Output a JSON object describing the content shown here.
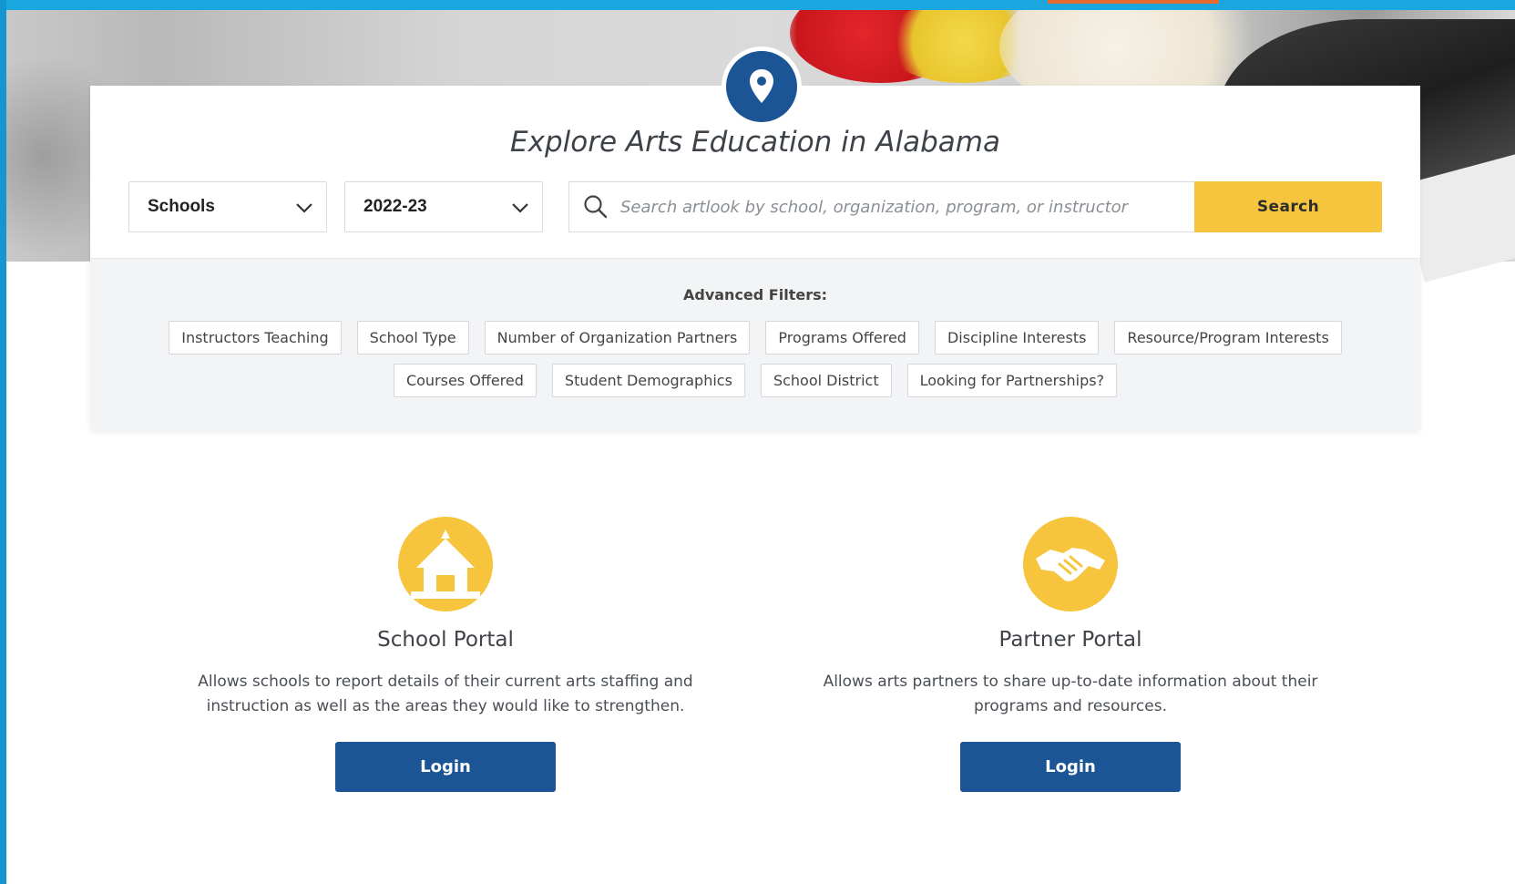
{
  "header": {
    "title": "Explore Arts Education in Alabama"
  },
  "search": {
    "type_select": "Schools",
    "year_select": "2022-23",
    "placeholder": "Search artlook by school, organization, program, or instructor",
    "button_label": "Search"
  },
  "filters": {
    "title": "Advanced Filters:",
    "row1": [
      "Instructors Teaching",
      "School Type",
      "Number of Organization Partners",
      "Programs Offered",
      "Discipline Interests",
      "Resource/Program Interests"
    ],
    "row2": [
      "Courses Offered",
      "Student Demographics",
      "School District",
      "Looking for Partnerships?"
    ]
  },
  "portals": {
    "school": {
      "title": "School Portal",
      "description": "Allows schools to report details of their current arts staffing and instruction as well as the areas they would like to strengthen.",
      "button": "Login",
      "icon": "school-house-icon"
    },
    "partner": {
      "title": "Partner Portal",
      "description": "Allows arts partners to share up-to-date information about their programs and resources.",
      "button": "Login",
      "icon": "handshake-icon"
    }
  },
  "colors": {
    "brand_blue": "#1b5595",
    "accent_yellow": "#f6c53d",
    "frame_blue": "#1aa6df"
  }
}
